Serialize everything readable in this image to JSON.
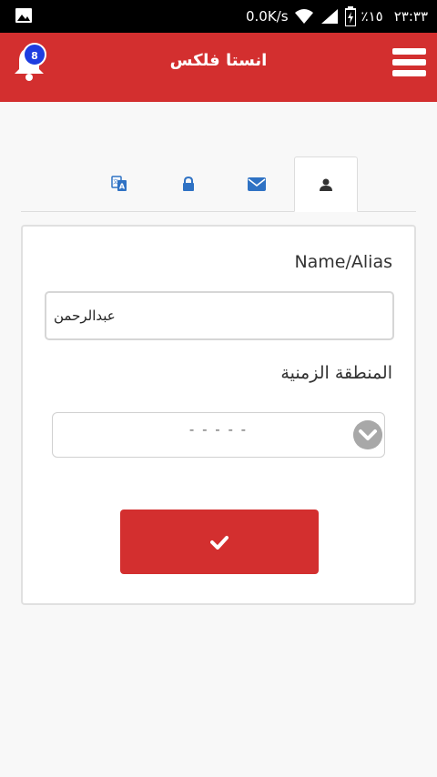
{
  "status_bar": {
    "network_speed": "0.0K/s",
    "battery": "٪١٥",
    "time": "٢٣:٣٣"
  },
  "app_bar": {
    "title": "انستا فلكس",
    "notification_count": "8"
  },
  "tabs": [
    {
      "icon": "translate-icon",
      "active": false
    },
    {
      "icon": "lock-icon",
      "active": false
    },
    {
      "icon": "envelope-icon",
      "active": false
    },
    {
      "icon": "user-icon",
      "active": true
    }
  ],
  "form": {
    "name_label": "Name/Alias",
    "name_value": "عبدالرحمن",
    "timezone_label": "المنطقة الزمنية",
    "timezone_selected": "- - - - -",
    "submit_icon": "check-icon"
  },
  "colors": {
    "primary": "#d32f2f",
    "tab_icon": "#2f72c4",
    "badge": "#1e3de0"
  }
}
